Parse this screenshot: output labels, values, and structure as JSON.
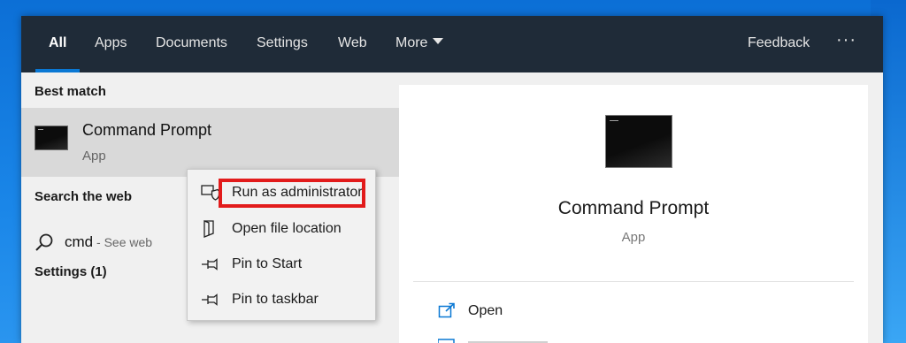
{
  "topbar": {
    "tabs": [
      {
        "label": "All",
        "active": true
      },
      {
        "label": "Apps"
      },
      {
        "label": "Documents"
      },
      {
        "label": "Settings"
      },
      {
        "label": "Web"
      },
      {
        "label": "More"
      }
    ],
    "feedback_label": "Feedback",
    "more_options_label": "···"
  },
  "left": {
    "best_match_heading": "Best match",
    "best_match": {
      "title": "Command Prompt",
      "subtitle": "App",
      "icon": "command-prompt-icon"
    },
    "search_web_heading": "Search the web",
    "web_result": {
      "query": "cmd",
      "suffix": " - See web",
      "icon": "search-icon"
    },
    "settings_heading": "Settings (1)"
  },
  "context_menu": {
    "items": [
      {
        "label": "Run as administrator",
        "icon": "shield-icon"
      },
      {
        "label": "Open file location",
        "icon": "file-location-icon"
      },
      {
        "label": "Pin to Start",
        "icon": "pin-icon"
      },
      {
        "label": "Pin to taskbar",
        "icon": "pin-icon"
      }
    ],
    "highlight_color": "#e21b1b"
  },
  "right": {
    "title": "Command Prompt",
    "subtitle": "App",
    "actions": [
      {
        "label": "Open",
        "icon": "open-icon"
      }
    ]
  },
  "colors": {
    "topbar": "#1f2b38",
    "accent": "#0a78d4",
    "desktop": "#1a86e8"
  }
}
